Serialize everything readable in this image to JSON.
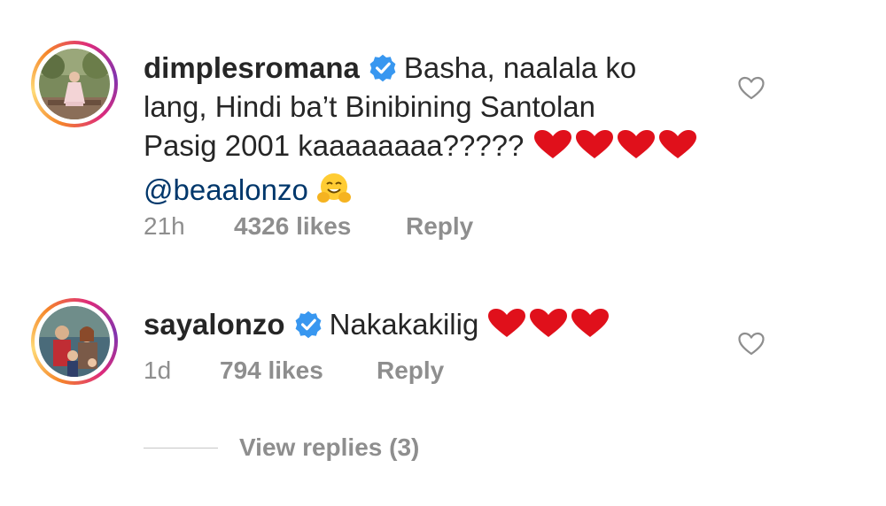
{
  "comments": [
    {
      "username": "dimplesromana",
      "text_line1": "Basha, naalala ko",
      "text_line2": "lang, Hindi ba’t Binibining Santolan",
      "text_line3": "Pasig 2001 kaaaaaaaa?????",
      "mention": "@beaalonzo",
      "time": "21h",
      "likes": "4326 likes",
      "reply": "Reply",
      "hearts_in_text": 4,
      "trailing_emoji": "hugging-face"
    },
    {
      "username": "sayalonzo",
      "text": "Nakakakilig",
      "time": "1d",
      "likes": "794 likes",
      "reply": "Reply",
      "hearts_in_text": 3
    }
  ],
  "view_replies": "View replies (3)",
  "colors": {
    "text": "#262626",
    "meta": "#8e8e8e",
    "mention": "#00376b",
    "verified": "#3897f0",
    "heart_emoji": "#e0101b"
  }
}
